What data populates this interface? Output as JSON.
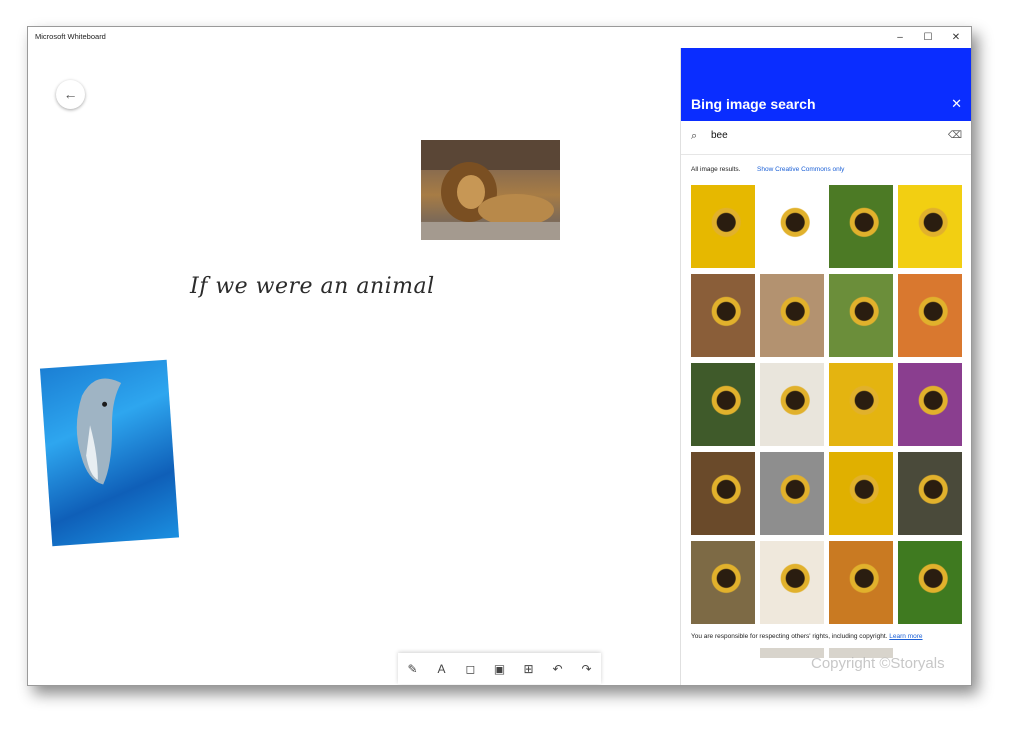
{
  "window": {
    "title": "Microsoft Whiteboard",
    "controls": {
      "minimize": "–",
      "maximize": "☐",
      "close": "✕"
    }
  },
  "canvas": {
    "back_icon": "←",
    "handwriting_text": "If we were an animal",
    "images": [
      "lion-photo",
      "dolphin-photo"
    ]
  },
  "toolbar": {
    "tools": [
      {
        "name": "pen",
        "glyph": "✎"
      },
      {
        "name": "text",
        "glyph": "A"
      },
      {
        "name": "sticky-note",
        "glyph": "◻"
      },
      {
        "name": "image",
        "glyph": "▣"
      },
      {
        "name": "insert",
        "glyph": "⊞"
      },
      {
        "name": "undo",
        "glyph": "↶"
      },
      {
        "name": "redo",
        "glyph": "↷"
      }
    ]
  },
  "panel": {
    "title": "Bing image search",
    "close_icon": "✕",
    "search": {
      "value": "bee",
      "search_icon": "⌕",
      "clear_icon": "⌫"
    },
    "results_label": "All image results.",
    "creative_commons_link": "Show Creative Commons only",
    "thumbnails": [
      {
        "label": "bee-image-1",
        "color": "#e6b800"
      },
      {
        "label": "bee-image-2",
        "color": "#ffffff"
      },
      {
        "label": "bee-image-3",
        "color": "#4c7a25"
      },
      {
        "label": "bee-image-4",
        "color": "#f2cf12"
      },
      {
        "label": "bee-image-5",
        "color": "#8a5e39"
      },
      {
        "label": "bee-image-6",
        "color": "#b39270"
      },
      {
        "label": "bee-image-7",
        "color": "#6b8e3a"
      },
      {
        "label": "bee-image-8",
        "color": "#d9782f"
      },
      {
        "label": "bee-image-9",
        "color": "#3f5a2a"
      },
      {
        "label": "bee-image-10",
        "color": "#e9e5dc"
      },
      {
        "label": "bee-image-11",
        "color": "#e4b410"
      },
      {
        "label": "bee-image-12",
        "color": "#8a3e8f"
      },
      {
        "label": "bee-image-13",
        "color": "#6a4a2a"
      },
      {
        "label": "bee-image-14",
        "color": "#8e8e8e"
      },
      {
        "label": "bee-image-15",
        "color": "#e0b000"
      },
      {
        "label": "bee-image-16",
        "color": "#4a4a3a"
      },
      {
        "label": "bee-image-17",
        "color": "#7d6a45"
      },
      {
        "label": "bee-image-18",
        "color": "#efe8dc"
      },
      {
        "label": "bee-image-19",
        "color": "#c97a22"
      },
      {
        "label": "bee-image-20",
        "color": "#3f7a20"
      }
    ],
    "footer_text": "You are responsible for respecting others' rights, including copyright.",
    "learn_more": "Learn more",
    "watermark": "Copyright ©Storyals"
  }
}
